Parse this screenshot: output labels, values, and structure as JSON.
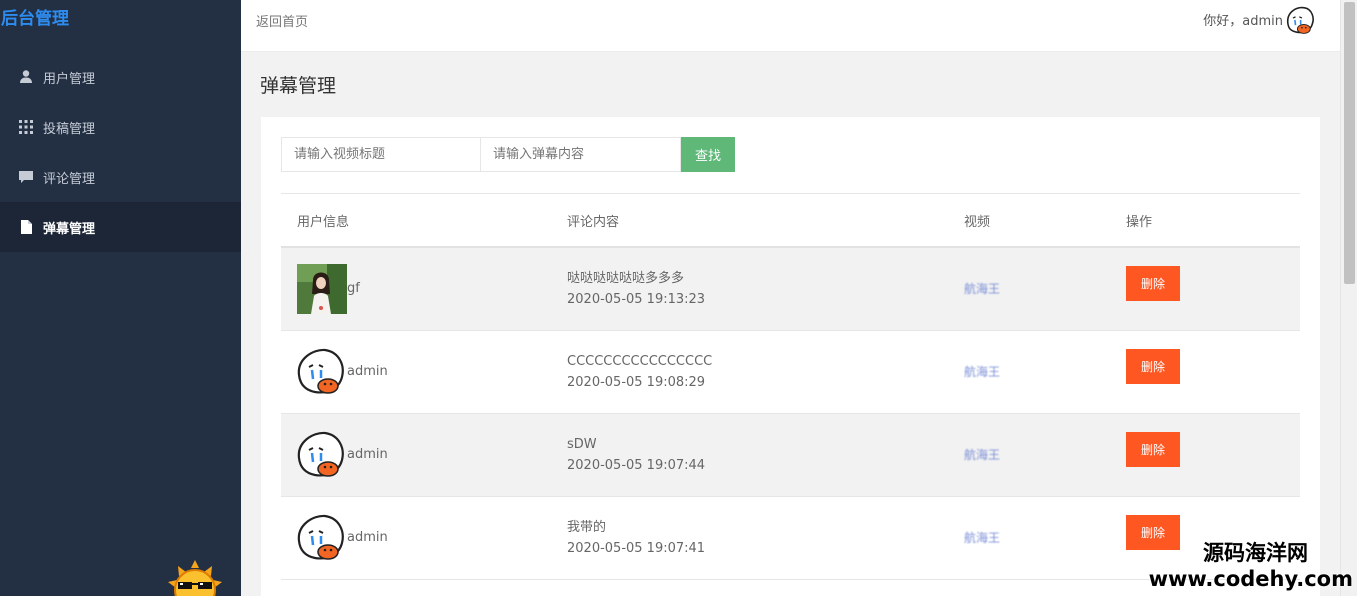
{
  "sidebar": {
    "logo": "后台管理",
    "items": [
      {
        "label": "用户管理",
        "icon": "user-icon",
        "active": false
      },
      {
        "label": "投稿管理",
        "icon": "grid-icon",
        "active": false
      },
      {
        "label": "评论管理",
        "icon": "comment-icon",
        "active": false
      },
      {
        "label": "弹幕管理",
        "icon": "file-icon",
        "active": true
      }
    ]
  },
  "topbar": {
    "back_label": "返回首页",
    "greeting": "你好，admin"
  },
  "page": {
    "title": "弹幕管理"
  },
  "search": {
    "title_placeholder": "请输入视频标题",
    "content_placeholder": "请输入弹幕内容",
    "button_label": "查找"
  },
  "table": {
    "headers": {
      "user": "用户信息",
      "content": "评论内容",
      "video": "视频",
      "op": "操作"
    },
    "rows": [
      {
        "user": "gf",
        "avatar": "photo",
        "content": "哒哒哒哒哒哒多多多",
        "time": "2020-05-05 19:13:23",
        "video": "航海王",
        "action": "删除"
      },
      {
        "user": "admin",
        "avatar": "cartoon",
        "content": "CCCCCCCCCCCCCCCC",
        "time": "2020-05-05 19:08:29",
        "video": "航海王",
        "action": "删除"
      },
      {
        "user": "admin",
        "avatar": "cartoon",
        "content": "sDW",
        "time": "2020-05-05 19:07:44",
        "video": "航海王",
        "action": "删除"
      },
      {
        "user": "admin",
        "avatar": "cartoon",
        "content": "我带的",
        "time": "2020-05-05 19:07:41",
        "video": "航海王",
        "action": "删除"
      }
    ]
  },
  "watermark": {
    "line1": "源码海洋网",
    "line2": "www.codehy.com"
  },
  "colors": {
    "sidebar_bg": "#233044",
    "logo": "#2d8cf0",
    "search_button": "#5fb878",
    "delete_button": "#ff5722"
  }
}
